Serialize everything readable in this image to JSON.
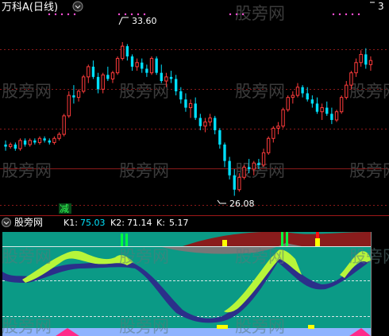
{
  "upper": {
    "title": "万科A(日线)",
    "right_label": "3",
    "marker": "减",
    "annotations": {
      "high": "33.60",
      "low": "26.08"
    },
    "watermark": "股旁网"
  },
  "lower": {
    "name": "股旁网",
    "k1": {
      "label": "K1:",
      "value": "75.03"
    },
    "k2": {
      "label": "K2:",
      "value": "71.14"
    },
    "k": {
      "label": "K:",
      "value": "5.17"
    }
  },
  "colors": {
    "up": "#ff3b3b",
    "down": "#00e0ff",
    "grid": "#8b1a1a",
    "lower_bg": "#0b9a86",
    "light_band": "#b7f53a",
    "dark_band": "#2b2f8a",
    "top_band": "#8a1c1c",
    "grey_band": "#888888",
    "green_bar": "#00ff40",
    "yellow_bar": "#ffff00",
    "red_bar": "#ff1010",
    "bottom_strip": "#8fb4ff",
    "bottom_pink": "#ff2a8a"
  },
  "chart_data": {
    "type": "candlestick",
    "high_label": 33.6,
    "low_label": 26.08,
    "ylim": [
      25.5,
      34.8
    ],
    "candles": [
      [
        28.6,
        28.8,
        28.3,
        28.5
      ],
      [
        28.5,
        28.7,
        28.4,
        28.6
      ],
      [
        28.6,
        28.7,
        28.3,
        28.4
      ],
      [
        28.4,
        28.9,
        28.3,
        28.8
      ],
      [
        28.8,
        28.9,
        28.5,
        28.6
      ],
      [
        28.6,
        28.9,
        28.5,
        28.8
      ],
      [
        28.8,
        28.9,
        28.6,
        28.7
      ],
      [
        28.7,
        29.0,
        28.6,
        28.9
      ],
      [
        28.9,
        29.0,
        28.7,
        28.8
      ],
      [
        28.8,
        28.9,
        28.6,
        28.7
      ],
      [
        28.7,
        29.0,
        28.6,
        28.9
      ],
      [
        28.9,
        29.2,
        28.8,
        29.1
      ],
      [
        29.1,
        30.1,
        29.0,
        30.0
      ],
      [
        30.0,
        31.2,
        29.9,
        31.0
      ],
      [
        31.0,
        31.5,
        30.6,
        30.9
      ],
      [
        30.9,
        31.3,
        30.7,
        31.2
      ],
      [
        31.2,
        32.0,
        31.1,
        31.9
      ],
      [
        31.9,
        32.5,
        31.6,
        32.4
      ],
      [
        32.4,
        32.7,
        31.8,
        31.9
      ],
      [
        31.9,
        32.1,
        31.1,
        31.3
      ],
      [
        31.3,
        32.1,
        31.1,
        32.0
      ],
      [
        32.0,
        32.4,
        31.7,
        31.8
      ],
      [
        31.8,
        32.2,
        31.6,
        32.1
      ],
      [
        32.1,
        32.9,
        32.0,
        32.8
      ],
      [
        32.8,
        33.6,
        32.7,
        33.4
      ],
      [
        33.4,
        33.5,
        32.7,
        32.9
      ],
      [
        32.9,
        33.0,
        32.2,
        32.4
      ],
      [
        32.4,
        32.8,
        32.2,
        32.6
      ],
      [
        32.6,
        32.8,
        32.1,
        32.3
      ],
      [
        32.3,
        32.5,
        31.9,
        32.1
      ],
      [
        32.1,
        32.9,
        32.0,
        32.8
      ],
      [
        32.8,
        32.9,
        32.0,
        32.1
      ],
      [
        32.1,
        32.5,
        31.6,
        31.7
      ],
      [
        31.7,
        32.1,
        31.4,
        31.9
      ],
      [
        31.9,
        32.2,
        31.6,
        31.8
      ],
      [
        31.8,
        32.0,
        31.0,
        31.2
      ],
      [
        31.2,
        31.4,
        30.6,
        30.8
      ],
      [
        30.8,
        31.1,
        30.2,
        30.4
      ],
      [
        30.4,
        30.8,
        29.9,
        30.6
      ],
      [
        30.6,
        30.9,
        29.8,
        29.9
      ],
      [
        29.9,
        30.1,
        29.3,
        29.5
      ],
      [
        29.5,
        29.9,
        29.2,
        29.7
      ],
      [
        29.7,
        30.1,
        29.5,
        29.9
      ],
      [
        29.9,
        30.0,
        29.1,
        29.3
      ],
      [
        29.3,
        29.4,
        28.4,
        28.6
      ],
      [
        28.6,
        28.7,
        27.5,
        27.8
      ],
      [
        27.8,
        28.0,
        26.9,
        27.1
      ],
      [
        27.1,
        27.4,
        26.1,
        26.4
      ],
      [
        26.4,
        27.2,
        26.3,
        27.0
      ],
      [
        27.0,
        27.6,
        26.9,
        27.5
      ],
      [
        27.5,
        27.9,
        27.2,
        27.4
      ],
      [
        27.4,
        27.8,
        27.1,
        27.7
      ],
      [
        27.7,
        27.9,
        27.4,
        27.6
      ],
      [
        27.6,
        28.4,
        27.5,
        28.2
      ],
      [
        28.2,
        29.0,
        28.1,
        28.9
      ],
      [
        28.9,
        29.5,
        28.7,
        29.4
      ],
      [
        29.4,
        29.7,
        29.1,
        29.5
      ],
      [
        29.5,
        30.4,
        29.4,
        30.3
      ],
      [
        30.3,
        31.0,
        30.2,
        30.9
      ],
      [
        30.9,
        31.2,
        30.6,
        31.0
      ],
      [
        31.0,
        31.6,
        30.9,
        31.4
      ],
      [
        31.4,
        31.5,
        30.9,
        31.1
      ],
      [
        31.1,
        31.4,
        30.7,
        30.8
      ],
      [
        30.8,
        31.0,
        30.4,
        30.6
      ],
      [
        30.6,
        30.9,
        30.1,
        30.2
      ],
      [
        30.2,
        30.6,
        29.8,
        30.4
      ],
      [
        30.4,
        30.7,
        30.0,
        30.1
      ],
      [
        30.1,
        30.4,
        29.6,
        29.8
      ],
      [
        29.8,
        30.3,
        29.7,
        30.2
      ],
      [
        30.2,
        31.0,
        30.1,
        30.9
      ],
      [
        30.9,
        31.7,
        30.8,
        31.5
      ],
      [
        31.5,
        32.2,
        31.3,
        32.1
      ],
      [
        32.1,
        32.8,
        31.9,
        32.6
      ],
      [
        32.6,
        33.2,
        32.4,
        33.0
      ],
      [
        33.0,
        33.3,
        32.3,
        32.5
      ],
      [
        32.5,
        32.9,
        32.2,
        32.7
      ]
    ]
  }
}
